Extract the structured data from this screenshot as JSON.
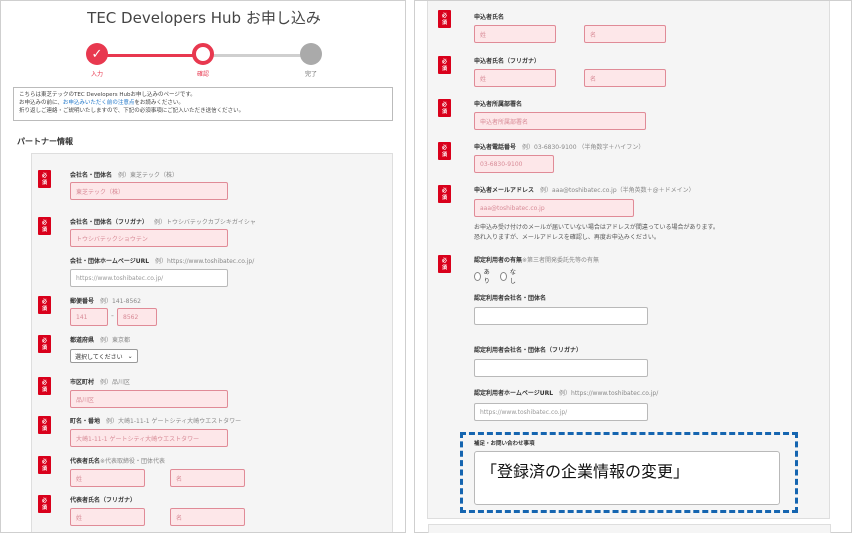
{
  "header": {
    "title": "TEC Developers Hub お申し込み"
  },
  "steps": [
    {
      "label": "入力",
      "symbol": "✓"
    },
    {
      "label": "確認",
      "symbol": ""
    },
    {
      "label": "完了",
      "symbol": ""
    }
  ],
  "notice": {
    "line1": "こちらは東芝テックのTEC Developers Hubお申し込みのページです。",
    "line2_prefix": "お申込みの前に、",
    "line2_link": "お申込みいただく前の注意点",
    "line2_suffix": "をお読みください。",
    "line3": "折り返しご連絡・ご説明いたしますので、下記の必須事項にご記入いただき送信ください。"
  },
  "section_title": "パートナー情報",
  "required_badge": "必須",
  "left_fields": {
    "company_name": {
      "label": "会社名・団体名",
      "example": "例）東芝テック（株）",
      "placeholder": "東芝テック（株）"
    },
    "company_kana": {
      "label": "会社名・団体名（フリガナ）",
      "example": "例）トウシバテックカブシキガイシャ",
      "placeholder": "トウシバテックショウテン"
    },
    "company_url": {
      "label": "会社・団体ホームページURL",
      "example": "例）https://www.toshibatec.co.jp/",
      "placeholder": "https://www.toshibatec.co.jp/"
    },
    "postal": {
      "label": "郵便番号",
      "example": "例）141-8562",
      "part1": "141",
      "part2": "8562",
      "dash": "-"
    },
    "prefecture": {
      "label": "都道府県",
      "example": "例）東京都",
      "selected": "選択してください"
    },
    "city": {
      "label": "市区町村",
      "example": "例）品川区",
      "placeholder": "品川区"
    },
    "address": {
      "label": "町名・番地",
      "example": "例）大崎1-11-1 ゲートシティ大崎ウエストタワー",
      "placeholder": "大崎1-11-1 ゲートシティ大崎ウエストタワー"
    },
    "rep_name": {
      "label": "代表者氏名",
      "note": "※代表取締役・団体代表",
      "last": "姓",
      "first": "名"
    },
    "rep_kana": {
      "label": "代表者氏名（フリガナ）",
      "last": "姓",
      "first": "名"
    }
  },
  "right_fields": {
    "applicant_name": {
      "label": "申込者氏名",
      "last": "姓",
      "first": "名"
    },
    "applicant_kana": {
      "label": "申込者氏名（フリガナ）",
      "last": "姓",
      "first": "名"
    },
    "department": {
      "label": "申込者所属部署名",
      "placeholder": "申込者所属部署名"
    },
    "phone": {
      "label": "申込者電話番号",
      "example": "例）03-6830-9100 （半角数字＋ハイフン）",
      "placeholder": "03-6830-9100"
    },
    "email": {
      "label": "申込者メールアドレス",
      "example": "例）aaa@toshibatec.co.jp（半角英数＋@＋ドメイン）",
      "placeholder": "aaa@toshibatec.co.jp",
      "help1": "お申込み受け付けのメールが届いていない場合はアドレスが間違っている場合があります。",
      "help2": "恐れ入りますが、メールアドレスを確認し、再度お申込みください。"
    },
    "certified_user": {
      "label": "認定利用者の有無",
      "note": "※第三者開発委託先等の有無",
      "option_yes": "あり",
      "option_no": "なし"
    },
    "certified_company": {
      "label": "認定利用者会社名・団体名"
    },
    "certified_kana": {
      "label": "認定利用者会社名・団体名（フリガナ）"
    },
    "certified_url": {
      "label": "認定利用者ホームページURL",
      "example": "例）https://www.toshibatec.co.jp/",
      "placeholder": "https://www.toshibatec.co.jp/"
    },
    "inquiry": {
      "label": "補足・お問い合わせ事項",
      "value": "「登録済の企業情報の変更」"
    }
  }
}
